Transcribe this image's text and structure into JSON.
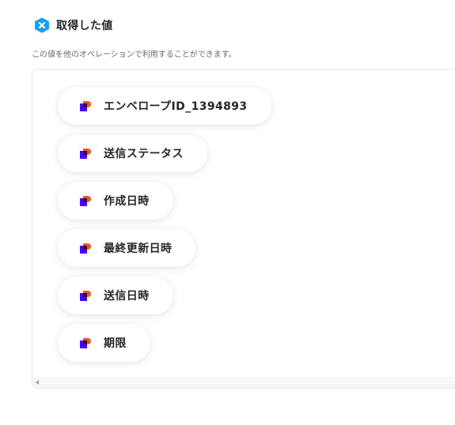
{
  "header": {
    "title": "取得した値",
    "icon": "x-badge-icon",
    "icon_color": "#1aa0e8"
  },
  "description": "この値を他のオペレーションで利用することができます。",
  "values": [
    {
      "label": "エンベロープID_1394893",
      "icon": "docusign-app-icon"
    },
    {
      "label": "送信ステータス",
      "icon": "docusign-app-icon"
    },
    {
      "label": "作成日時",
      "icon": "docusign-app-icon"
    },
    {
      "label": "最終更新日時",
      "icon": "docusign-app-icon"
    },
    {
      "label": "送信日時",
      "icon": "docusign-app-icon"
    },
    {
      "label": "期限",
      "icon": "docusign-app-icon"
    }
  ],
  "colors": {
    "app_icon_primary": "#ff4f2e",
    "app_icon_secondary": "#4b00ff",
    "app_icon_dark": "#1a1a1a"
  }
}
